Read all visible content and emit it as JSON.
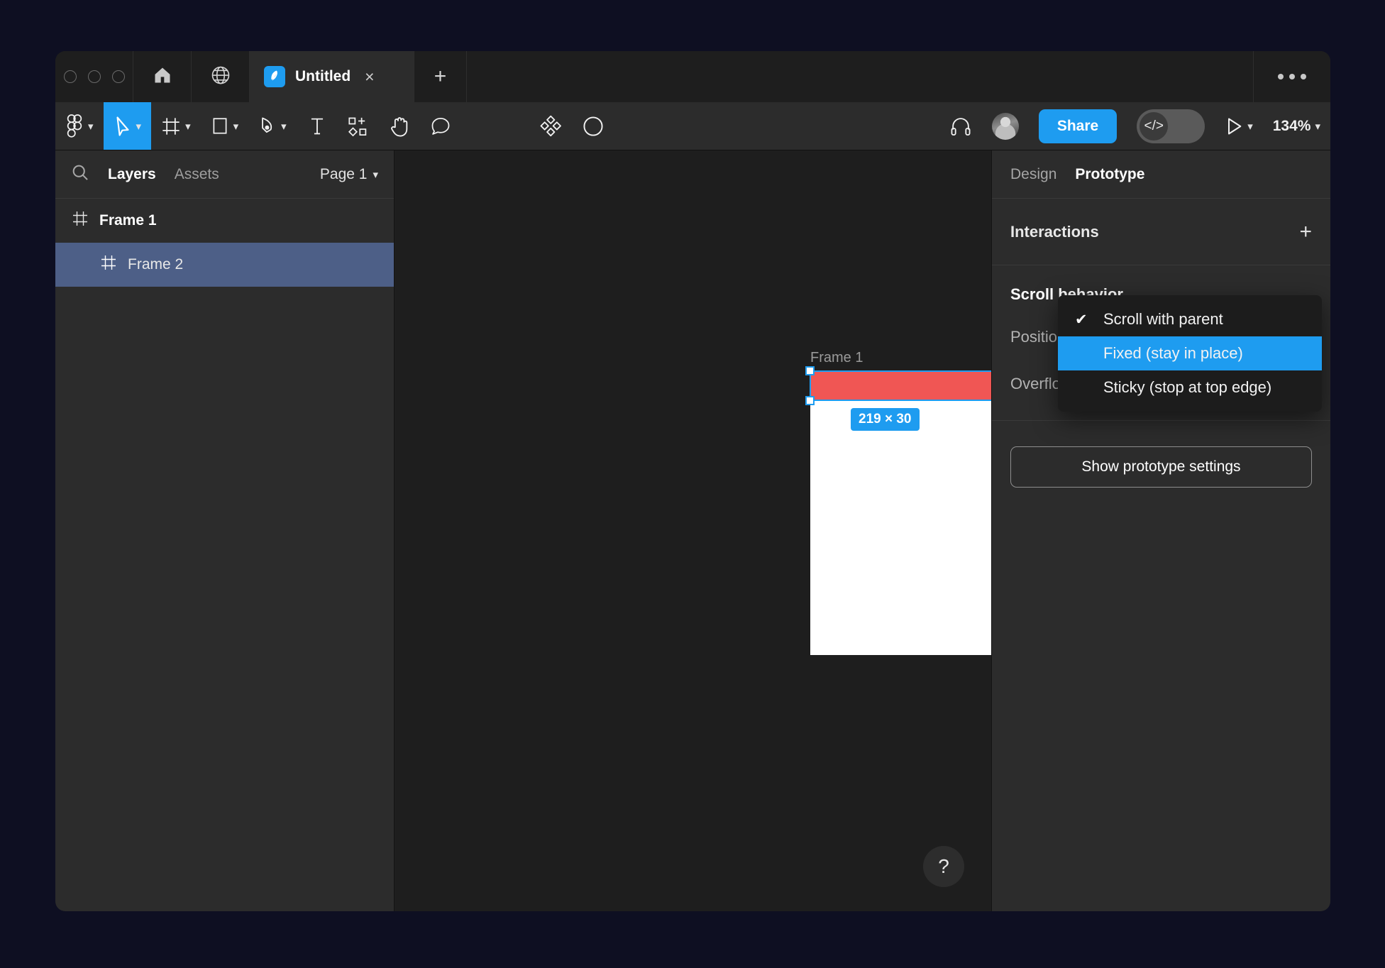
{
  "window": {
    "titlebar": {
      "traffic_lights": [
        "close",
        "minimize",
        "maximize"
      ],
      "home_icon": "home-icon",
      "globe_icon": "globe-icon",
      "tab": {
        "favicon": "figma-icon",
        "title": "Untitled",
        "close": "×"
      },
      "new_tab": "+",
      "overflow_menu": "ellipsis-icon"
    },
    "toolbar": {
      "tools": [
        {
          "name": "figma-menu-tool",
          "icon": "figma-logo-icon",
          "has_chevron": true,
          "active": false
        },
        {
          "name": "move-tool",
          "icon": "cursor-icon",
          "has_chevron": true,
          "active": true
        },
        {
          "name": "frame-tool",
          "icon": "frame-icon",
          "has_chevron": true,
          "active": false
        },
        {
          "name": "shape-tool",
          "icon": "rectangle-icon",
          "has_chevron": true,
          "active": false
        },
        {
          "name": "pen-tool",
          "icon": "pen-icon",
          "has_chevron": true,
          "active": false
        },
        {
          "name": "text-tool",
          "icon": "text-icon",
          "has_chevron": false,
          "active": false
        },
        {
          "name": "components-tool",
          "icon": "components-icon",
          "has_chevron": false,
          "active": false
        },
        {
          "name": "hand-tool",
          "icon": "hand-icon",
          "has_chevron": false,
          "active": false
        },
        {
          "name": "comment-tool",
          "icon": "comment-icon",
          "has_chevron": false,
          "active": false
        }
      ],
      "plugins_icon": "plugins-diamond-icon",
      "contrast_icon": "contrast-icon",
      "headphones_icon": "headphones-icon",
      "avatar": "user-avatar",
      "share_label": "Share",
      "dev_mode_icon": "code-icon",
      "present_icon": "play-icon",
      "zoom_level": "134%",
      "accent_color": "#1e9cf0"
    },
    "left_panel": {
      "search_icon": "search-icon",
      "tabs": [
        {
          "label": "Layers",
          "active": true
        },
        {
          "label": "Assets",
          "active": false
        }
      ],
      "page_selector": "Page 1",
      "layers": [
        {
          "name": "Frame 1",
          "icon": "frame-icon",
          "indent": 0,
          "selected": false
        },
        {
          "name": "Frame 2",
          "icon": "frame-icon",
          "indent": 1,
          "selected": true
        }
      ],
      "selected_color": "#4d5f87"
    },
    "canvas": {
      "frame_label": "Frame 1",
      "size_badge": "219 × 30",
      "rect_fill": "#f05654",
      "frame_fill": "#ffffff",
      "selection_color": "#1e9cf0",
      "help_icon": "?"
    },
    "right_panel": {
      "tabs": [
        {
          "label": "Design",
          "active": false
        },
        {
          "label": "Prototype",
          "active": true
        }
      ],
      "interactions": {
        "title": "Interactions",
        "add_icon": "+"
      },
      "scroll_behavior": {
        "title": "Scroll behavior",
        "position_label": "Position",
        "overflow_label": "Overflow"
      },
      "prototype_settings_label": "Show prototype settings",
      "dropdown": {
        "items": [
          {
            "label": "Scroll with parent",
            "checked": true,
            "highlighted": false
          },
          {
            "label": "Fixed (stay in place)",
            "checked": false,
            "highlighted": true
          },
          {
            "label": "Sticky (stop at top edge)",
            "checked": false,
            "highlighted": false
          }
        ],
        "check_glyph": "✔",
        "highlight_color": "#1e9cf0"
      }
    }
  }
}
